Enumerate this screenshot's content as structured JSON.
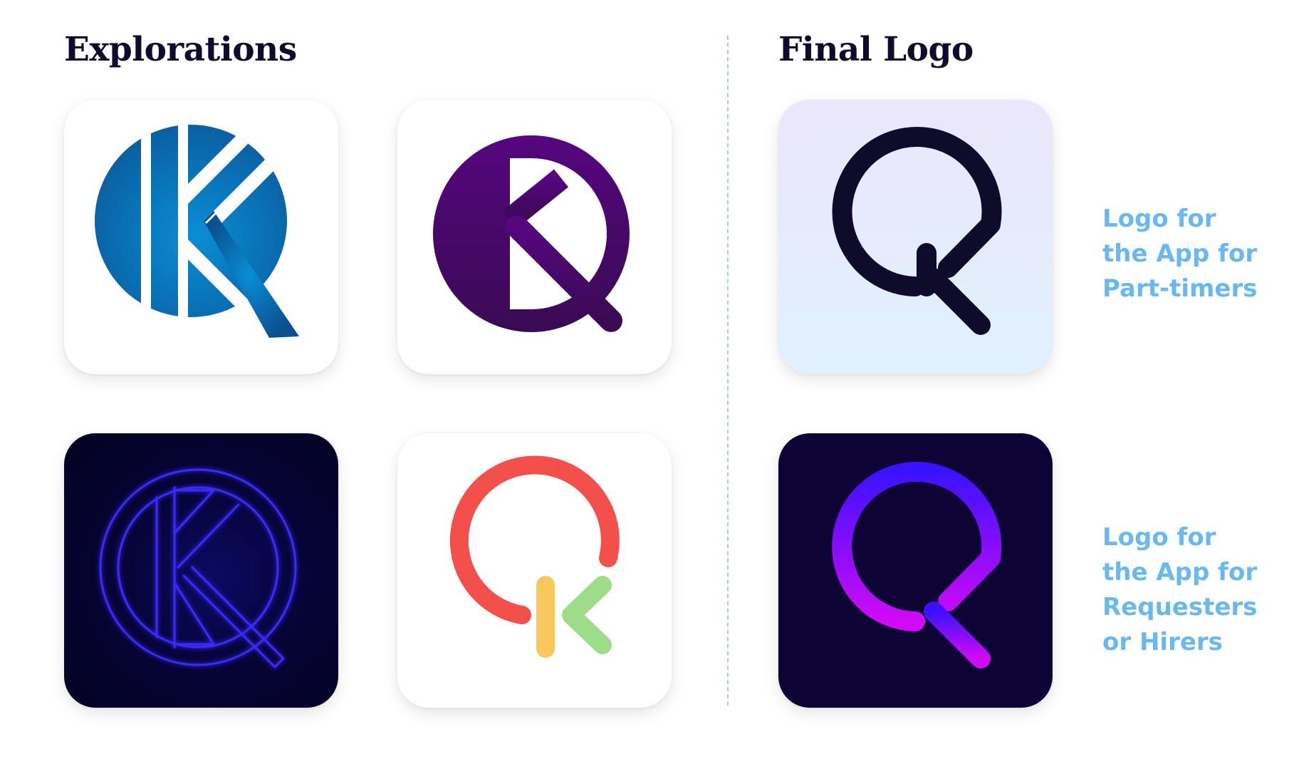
{
  "headings": {
    "explorations": "Explorations",
    "final": "Final Logo"
  },
  "captions": [
    {
      "lines": [
        "Logo for",
        "the App for",
        "Part-timers"
      ]
    },
    {
      "lines": [
        "Logo for",
        "the App for",
        "Requesters",
        "or Hirers"
      ]
    }
  ],
  "colors": {
    "heading": "#0f0c2b",
    "caption": "#69b9ef",
    "divider": "#a9cbe6",
    "blue_logo": "#1f86c9",
    "purple_logo": "#4e0a79",
    "neon_logo": "#3a2cff",
    "colorful_red": "#f4504b",
    "colorful_yellow": "#f9c85c",
    "colorful_green": "#9fdc8a",
    "final_light_mark": "#0f0c2b",
    "final_dark_gradient_top": "#3b12ff",
    "final_dark_gradient_bottom": "#d10af5"
  }
}
